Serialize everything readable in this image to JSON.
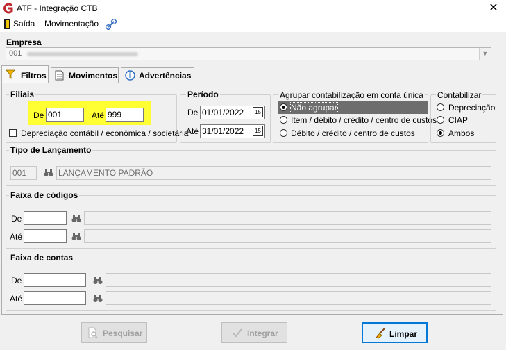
{
  "window": {
    "title": "ATF - Integração CTB",
    "close_symbol": "✕"
  },
  "menu": {
    "items": [
      "Saída",
      "Movimentação"
    ]
  },
  "empresa": {
    "label": "Empresa",
    "value": "001"
  },
  "tabs": [
    "Filtros",
    "Movimentos",
    "Advertências"
  ],
  "filiais": {
    "title": "Filiais",
    "de_label": "De",
    "de_value": "001",
    "ate_label": "Até",
    "ate_value": "999",
    "checkbox_label": "Depreciação contábil / econômica / societária"
  },
  "periodo": {
    "title": "Período",
    "de_label": "De",
    "de_value": "01/01/2022",
    "ate_label": "Até",
    "ate_value": "31/01/2022",
    "cal_glyph": "15"
  },
  "agrupar": {
    "title": "Agrupar contabilização em conta única",
    "options": [
      "Não agrupar",
      "Item / débito / crédito / centro de custos",
      "Débito / crédito / centro de custos"
    ],
    "selected": 0
  },
  "contabilizar": {
    "title": "Contabilizar",
    "options": [
      "Depreciação",
      "CIAP",
      "Ambos"
    ],
    "selected": 2
  },
  "tipo_lancamento": {
    "title": "Tipo de Lançamento",
    "code": "001",
    "description": "LANÇAMENTO PADRÃO"
  },
  "faixa_codigos": {
    "title": "Faixa de códigos",
    "de_label": "De",
    "ate_label": "Até"
  },
  "faixa_contas": {
    "title": "Faixa de contas",
    "de_label": "De",
    "ate_label": "Até"
  },
  "buttons": {
    "pesquisar": "Pesquisar",
    "integrar": "Integrar",
    "limpar": "Limpar"
  },
  "colors": {
    "highlight": "#ffff33",
    "selected_item": "#6d6d6d",
    "accent": "#0078d7"
  }
}
